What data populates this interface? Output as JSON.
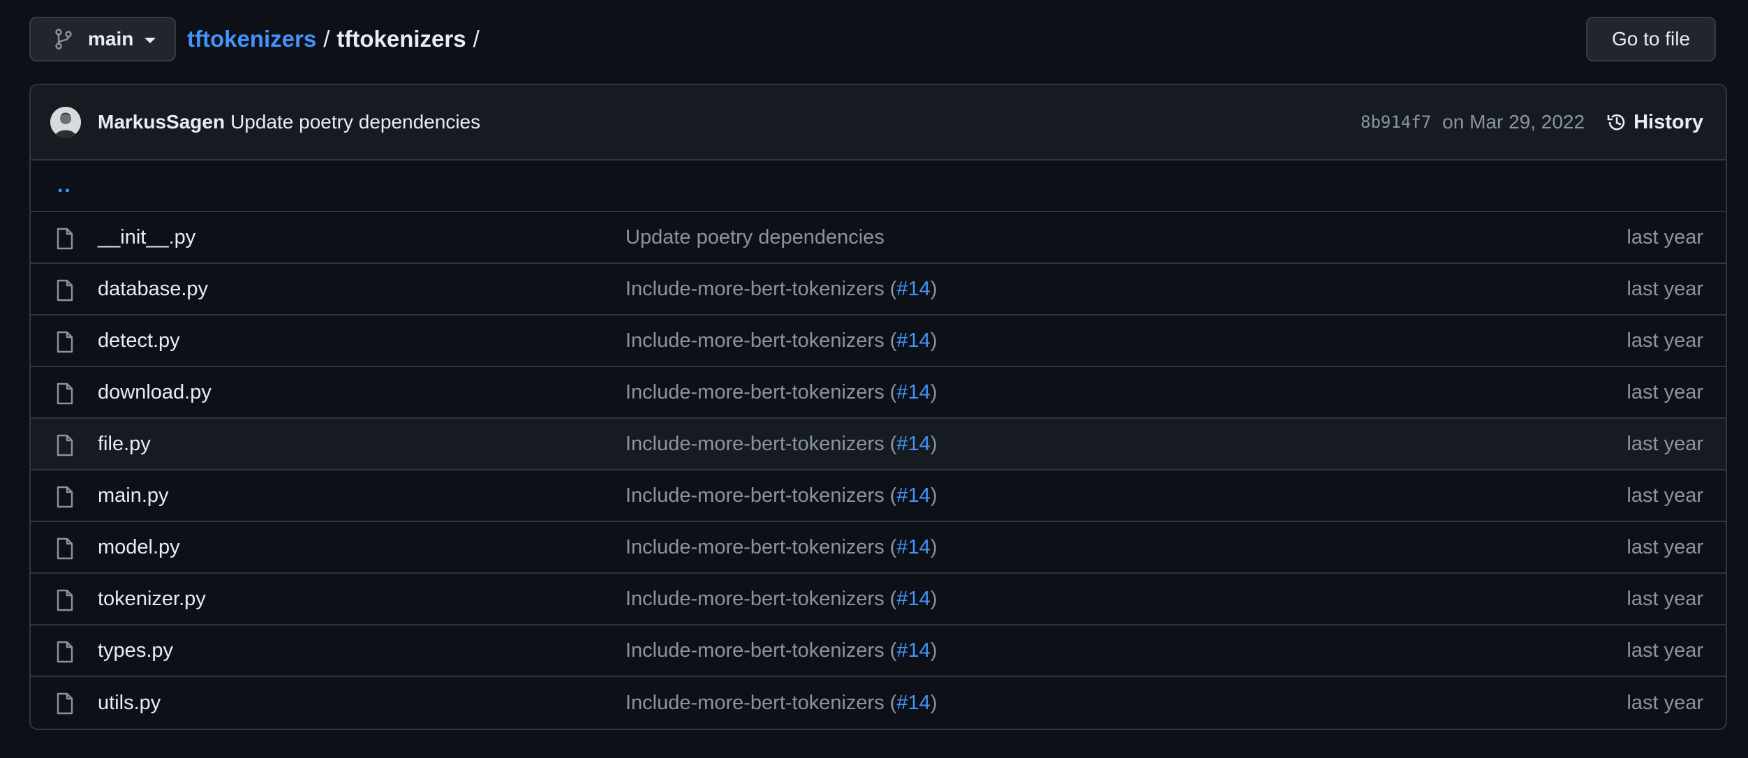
{
  "branch": {
    "name": "main"
  },
  "breadcrumb": {
    "repo": "tftokenizers",
    "sep1": "/",
    "folder": "tftokenizers",
    "sep2": "/"
  },
  "goto_file": {
    "label": "Go to file"
  },
  "latest_commit": {
    "author": "MarkusSagen",
    "message": "Update poetry dependencies",
    "sha": "8b914f7",
    "date": "on Mar 29, 2022",
    "history_label": "History"
  },
  "parent_dir": {
    "label": ".."
  },
  "files": [
    {
      "name": "__init__.py",
      "commit_msg": "Update poetry dependencies",
      "age": "last year"
    },
    {
      "name": "database.py",
      "commit_msg": "Include-more-bert-tokenizers (",
      "pr": "#14",
      "close": ")",
      "age": "last year"
    },
    {
      "name": "detect.py",
      "commit_msg": "Include-more-bert-tokenizers (",
      "pr": "#14",
      "close": ")",
      "age": "last year"
    },
    {
      "name": "download.py",
      "commit_msg": "Include-more-bert-tokenizers (",
      "pr": "#14",
      "close": ")",
      "age": "last year"
    },
    {
      "name": "file.py",
      "commit_msg": "Include-more-bert-tokenizers (",
      "pr": "#14",
      "close": ")",
      "age": "last year"
    },
    {
      "name": "main.py",
      "commit_msg": "Include-more-bert-tokenizers (",
      "pr": "#14",
      "close": ")",
      "age": "last year"
    },
    {
      "name": "model.py",
      "commit_msg": "Include-more-bert-tokenizers (",
      "pr": "#14",
      "close": ")",
      "age": "last year"
    },
    {
      "name": "tokenizer.py",
      "commit_msg": "Include-more-bert-tokenizers (",
      "pr": "#14",
      "close": ")",
      "age": "last year"
    },
    {
      "name": "types.py",
      "commit_msg": "Include-more-bert-tokenizers (",
      "pr": "#14",
      "close": ")",
      "age": "last year"
    },
    {
      "name": "utils.py",
      "commit_msg": "Include-more-bert-tokenizers (",
      "pr": "#14",
      "close": ")",
      "age": "last year"
    }
  ],
  "icons": {
    "branch": "git-branch-icon",
    "history": "history-icon",
    "file": "file-icon",
    "avatar": "user-avatar"
  },
  "colors": {
    "background": "#0d1117",
    "link": "#4493f8",
    "muted": "#8b949e",
    "border": "#30363d"
  }
}
